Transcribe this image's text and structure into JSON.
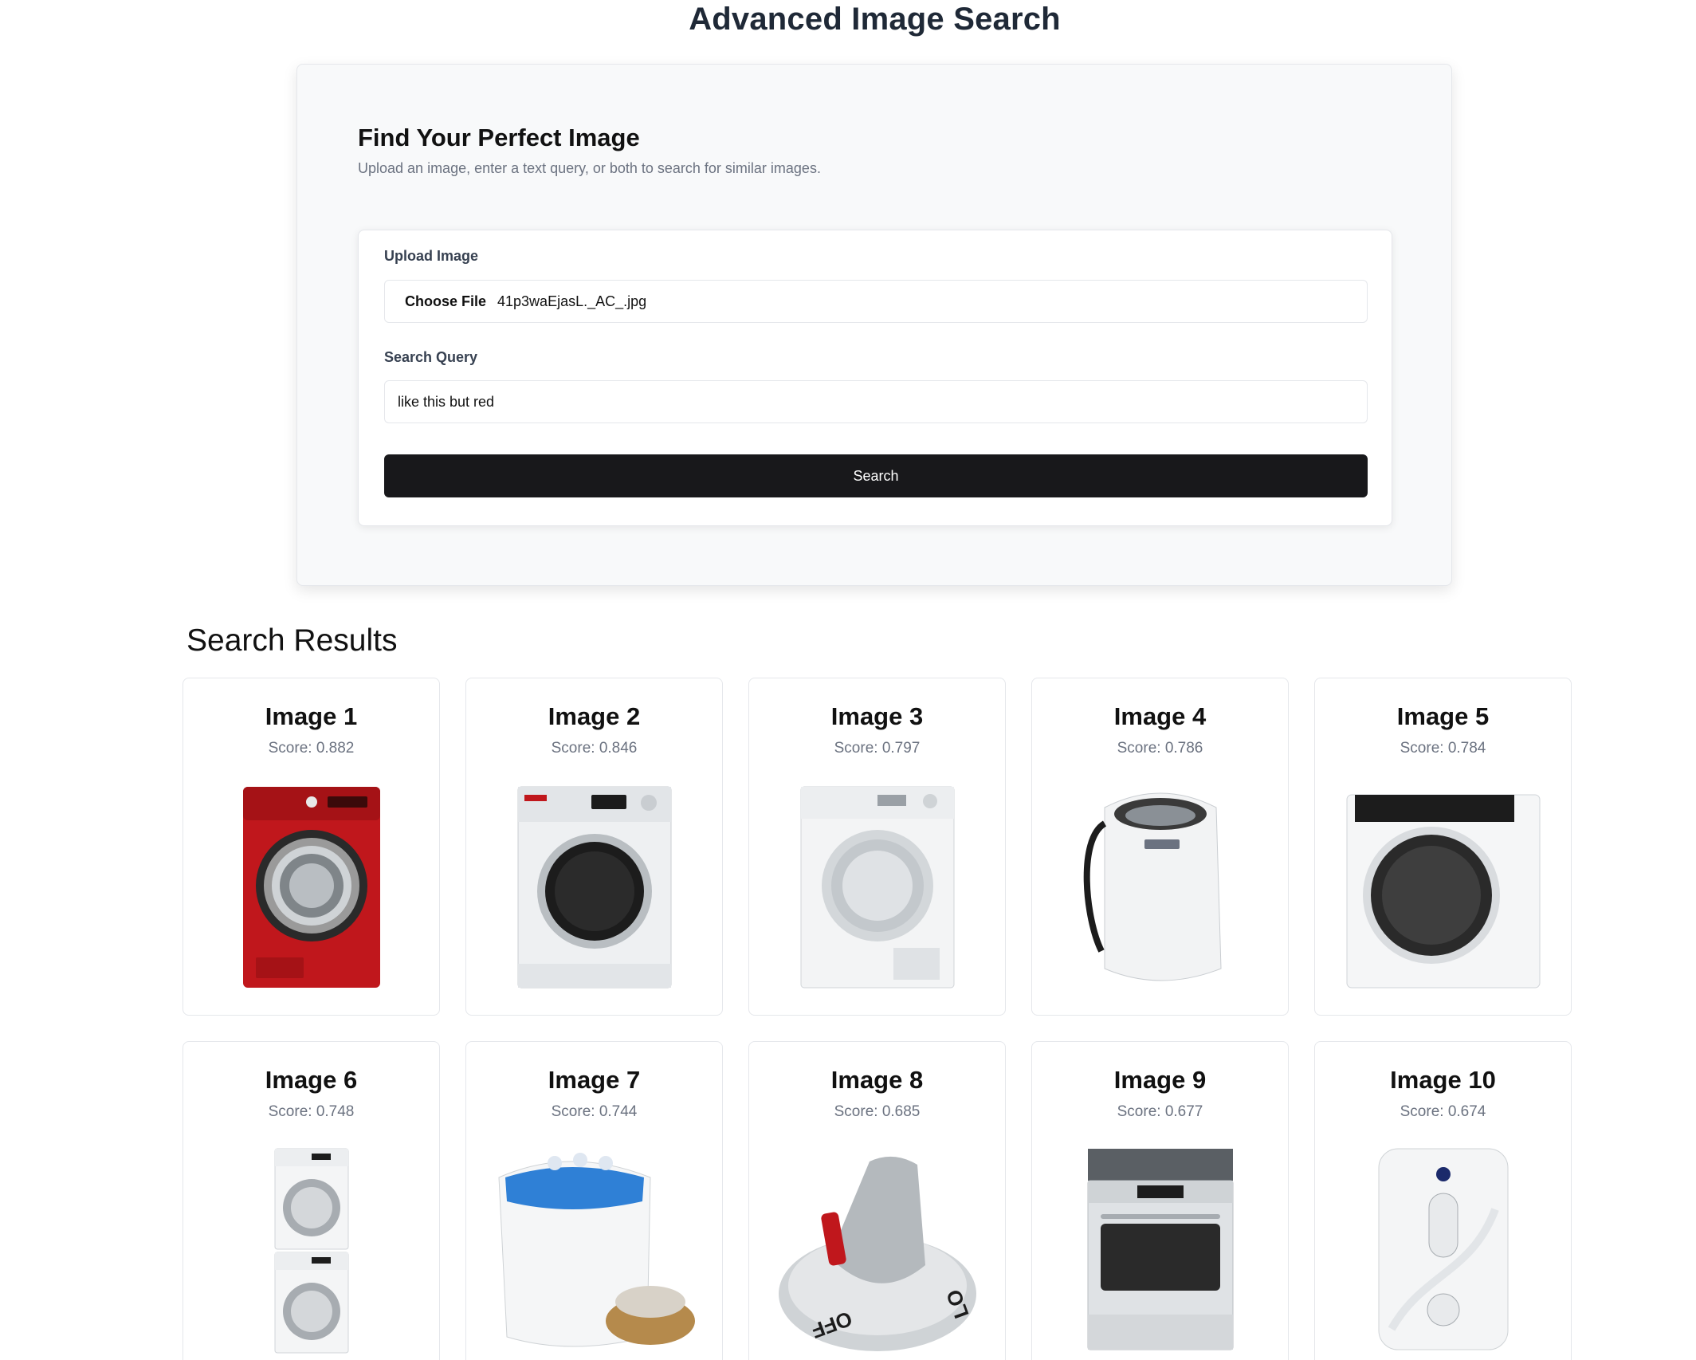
{
  "app": {
    "title": "Advanced Image Search"
  },
  "search_panel": {
    "heading": "Find Your Perfect Image",
    "description": "Upload an image, enter a text query, or both to search for similar images.",
    "upload": {
      "label": "Upload Image",
      "button_label": "Choose File",
      "file_name": "41p3waEjasL._AC_.jpg"
    },
    "query": {
      "label": "Search Query",
      "value": "like this but red"
    },
    "search_button": "Search"
  },
  "results": {
    "heading": "Search Results",
    "items": [
      {
        "title": "Image 1",
        "score": "Score: 0.882",
        "icon": "red-front-load-washer-image"
      },
      {
        "title": "Image 2",
        "score": "Score: 0.846",
        "icon": "white-compact-washer-image"
      },
      {
        "title": "Image 3",
        "score": "Score: 0.797",
        "icon": "white-dryer-image"
      },
      {
        "title": "Image 4",
        "score": "Score: 0.786",
        "icon": "portable-top-load-washer-image"
      },
      {
        "title": "Image 5",
        "score": "Score: 0.784",
        "icon": "white-compact-dryer-image"
      },
      {
        "title": "Image 6",
        "score": "Score: 0.748",
        "icon": "stacked-washer-dryer-image"
      },
      {
        "title": "Image 7",
        "score": "Score: 0.744",
        "icon": "twin-tub-washer-image"
      },
      {
        "title": "Image 8",
        "score": "Score: 0.685",
        "icon": "control-knob-image"
      },
      {
        "title": "Image 9",
        "score": "Score: 0.677",
        "icon": "gas-range-image"
      },
      {
        "title": "Image 10",
        "score": "Score: 0.674",
        "icon": "wall-switch-plate-image"
      }
    ]
  },
  "colors": {
    "washer_red": "#c0171c",
    "button_dark": "#18181b",
    "panel_bg": "#f8f9fa",
    "muted_text": "#6b7280"
  }
}
